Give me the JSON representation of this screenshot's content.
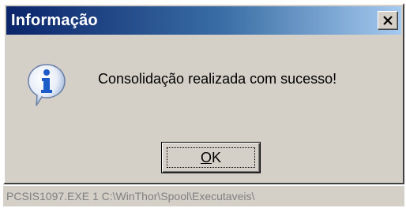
{
  "window": {
    "title": "Informação",
    "close_glyph": "✕"
  },
  "dialog": {
    "icon": "info-icon",
    "message": "Consolidação realizada com sucesso!",
    "ok_label_mnemonic": "O",
    "ok_label_rest": "K"
  },
  "status": {
    "text": "PCSIS1097.EXE 1 C:\\WinThor\\Spool\\Executaveis\\"
  },
  "colors": {
    "titlebar_start": "#0a246a",
    "titlebar_end": "#a6caf0",
    "face": "#d4d0c8",
    "icon_blue": "#1c5cc8"
  }
}
